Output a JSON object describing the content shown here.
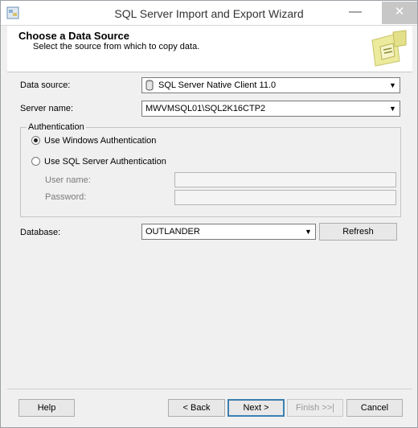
{
  "window": {
    "title": "SQL Server Import and Export Wizard"
  },
  "titlebar": {
    "minimize_glyph": "—",
    "close_glyph": "✕"
  },
  "header": {
    "title": "Choose a Data Source",
    "subtitle": "Select the source from which to copy data."
  },
  "form": {
    "data_source_label": "Data source:",
    "data_source_value": "SQL Server Native Client 11.0",
    "server_name_label": "Server name:",
    "server_name_value": "MWVMSQL01\\SQL2K16CTP2",
    "auth_group_label": "Authentication",
    "auth_windows_label": "Use Windows Authentication",
    "auth_sql_label": "Use SQL Server Authentication",
    "auth_selected": "windows",
    "user_name_label": "User name:",
    "user_name_value": "",
    "password_label": "Password:",
    "password_value": "",
    "database_label": "Database:",
    "database_value": "OUTLANDER",
    "refresh_label": "Refresh"
  },
  "footer": {
    "help_label": "Help",
    "back_label": "< Back",
    "next_label": "Next >",
    "finish_label": "Finish >>|",
    "cancel_label": "Cancel"
  },
  "icons": {
    "app": "wizard-app-icon",
    "header": "wizard-header-icon",
    "datasource": "database-provider-icon",
    "dropdown": "chevron-down-icon"
  },
  "colors": {
    "default_button_border": "#3c7fb1",
    "header_art_yellow": "#e9e79a"
  }
}
